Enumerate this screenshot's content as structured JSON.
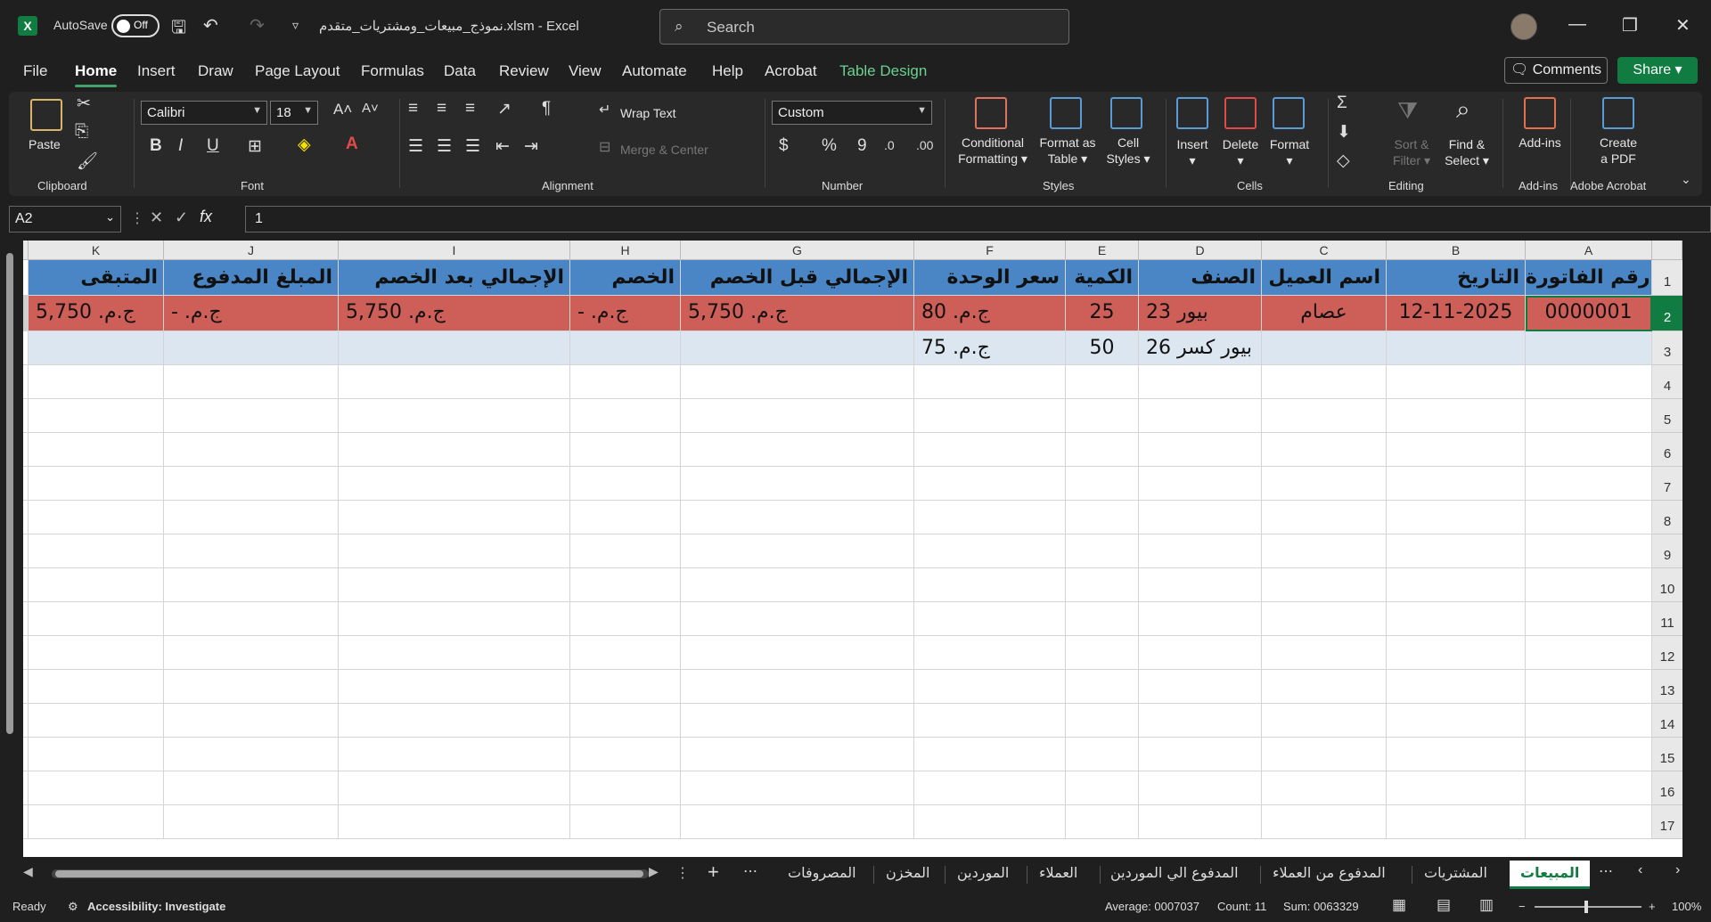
{
  "titlebar": {
    "autosave_label": "AutoSave",
    "autosave_state": "Off",
    "doc_title": "نموذج_مبيعات_ومشتريات_متقدم.xlsm  -  Excel",
    "search_placeholder": "Search"
  },
  "menu": {
    "items": [
      "File",
      "Home",
      "Insert",
      "Draw",
      "Page Layout",
      "Formulas",
      "Data",
      "Review",
      "View",
      "Automate",
      "Help",
      "Acrobat",
      "Table Design"
    ],
    "active": "Home",
    "comments_label": "Comments",
    "share_label": "Share"
  },
  "ribbon": {
    "clipboard": {
      "paste": "Paste",
      "label": "Clipboard"
    },
    "font": {
      "name": "Calibri",
      "size": "18",
      "label": "Font"
    },
    "alignment": {
      "wrap": "Wrap Text",
      "merge": "Merge & Center",
      "label": "Alignment"
    },
    "number": {
      "format": "Custom",
      "label": "Number"
    },
    "styles": {
      "cond1": "Conditional",
      "cond2": "Formatting",
      "fmt1": "Format as",
      "fmt2": "Table",
      "cell1": "Cell",
      "cell2": "Styles",
      "label": "Styles"
    },
    "cells": {
      "insert": "Insert",
      "delete": "Delete",
      "format": "Format",
      "label": "Cells"
    },
    "editing": {
      "sort1": "Sort &",
      "sort2": "Filter",
      "find1": "Find &",
      "find2": "Select",
      "label": "Editing"
    },
    "addins": {
      "btn": "Add-ins",
      "label": "Add-ins"
    },
    "acrobat": {
      "btn1": "Create",
      "btn2": "a PDF",
      "label": "Adobe Acrobat"
    }
  },
  "formula_bar": {
    "name_box": "A2",
    "fx": "fx",
    "value": "1"
  },
  "sheet": {
    "columns": [
      "A",
      "B",
      "C",
      "D",
      "E",
      "F",
      "G",
      "H",
      "I",
      "J",
      "K"
    ],
    "rows": [
      "1",
      "2",
      "3",
      "4",
      "5",
      "6",
      "7",
      "8",
      "9",
      "10",
      "11",
      "12",
      "13",
      "14",
      "15",
      "16",
      "17"
    ],
    "headers": [
      "رقم الفاتورة",
      "التاريخ",
      "اسم العميل",
      "الصنف",
      "الكمية",
      "سعر الوحدة",
      "الإجمالي قبل الخصم",
      "الخصم",
      "الإجمالي بعد الخصم",
      "المبلغ المدفوع",
      "المتبقى"
    ],
    "row2": [
      "0000001",
      "12-11-2025",
      "عصام",
      "بيور 23",
      "25",
      "ج.م.  80",
      "ج.م.  5,750",
      "ج.م.   -",
      "ج.م.  5,750",
      "ج.م.    -",
      "ج.م.  5,750"
    ],
    "row3": [
      "",
      "",
      "",
      "بيور كسر 26",
      "50",
      "ج.م.  75",
      "",
      "",
      "",
      "",
      ""
    ]
  },
  "tabs": [
    "المبيعات",
    "المشتريات",
    "المدفوع من العملاء",
    "المدفوع الي الموردين",
    "العملاء",
    "الموردين",
    "المخزن",
    "المصروفات"
  ],
  "active_tab": "المبيعات",
  "status": {
    "ready": "Ready",
    "accessibility": "Accessibility: Investigate",
    "average": "Average: 0007037",
    "count": "Count: 11",
    "sum": "Sum: 0063329",
    "zoom": "100%"
  },
  "colors": {
    "header_fill": "#4a86c5",
    "row2_fill": "#cd5f58",
    "row3_fill": "#dce6f1",
    "accent": "#107c41"
  }
}
